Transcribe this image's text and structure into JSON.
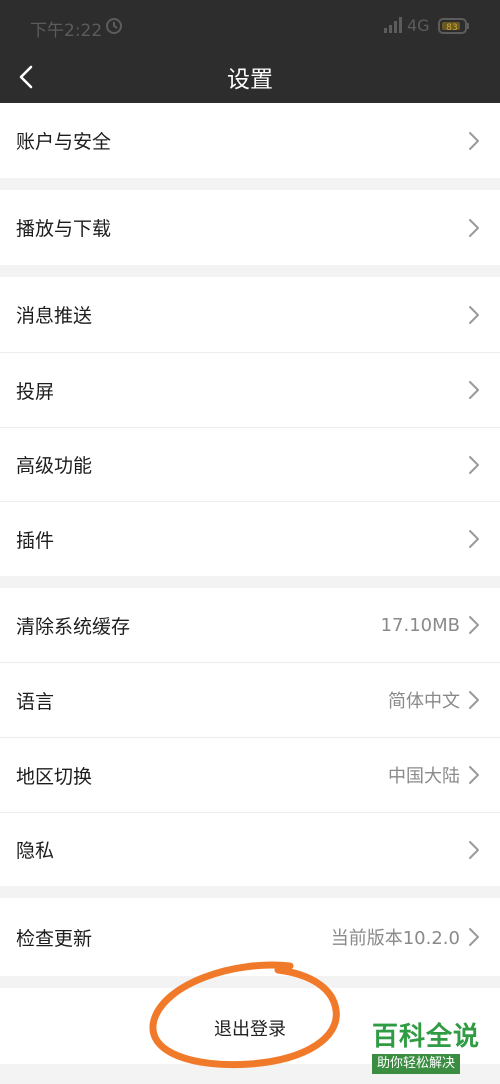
{
  "status_bar": {
    "time": "下午2:22",
    "network": "4G",
    "battery": "83"
  },
  "header": {
    "title": "设置"
  },
  "settings": {
    "account_security": {
      "label": "账户与安全"
    },
    "playback_download": {
      "label": "播放与下载"
    },
    "push_notifications": {
      "label": "消息推送"
    },
    "screen_cast": {
      "label": "投屏"
    },
    "advanced": {
      "label": "高级功能"
    },
    "plugins": {
      "label": "插件"
    },
    "clear_cache": {
      "label": "清除系统缓存",
      "value": "17.10MB"
    },
    "language": {
      "label": "语言",
      "value": "简体中文"
    },
    "region": {
      "label": "地区切换",
      "value": "中国大陆"
    },
    "privacy": {
      "label": "隐私"
    },
    "check_update": {
      "label": "检查更新",
      "value": "当前版本10.2.0"
    }
  },
  "logout": {
    "label": "退出登录"
  },
  "annotation": {
    "color": "#f07a2a"
  },
  "watermark": {
    "title": "百科全说",
    "subtitle": "助你轻松解决"
  }
}
